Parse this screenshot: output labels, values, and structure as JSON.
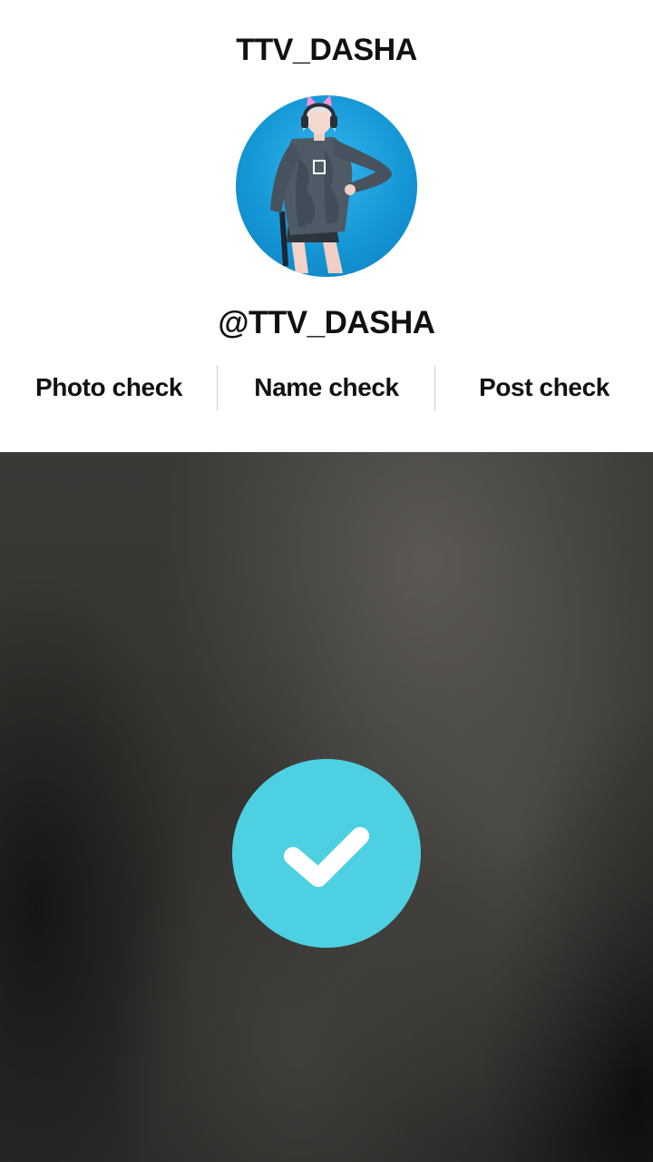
{
  "header": {
    "title": "TTV_DASHA"
  },
  "profile": {
    "handle": "@TTV_DASHA",
    "avatar_icon": "character-avatar-icon"
  },
  "check_tabs": [
    {
      "label": "Photo check"
    },
    {
      "label": "Name check"
    },
    {
      "label": "Post check"
    }
  ],
  "media": {
    "badge_icon": "checkmark-icon",
    "badge_color": "#4dd0e1"
  }
}
